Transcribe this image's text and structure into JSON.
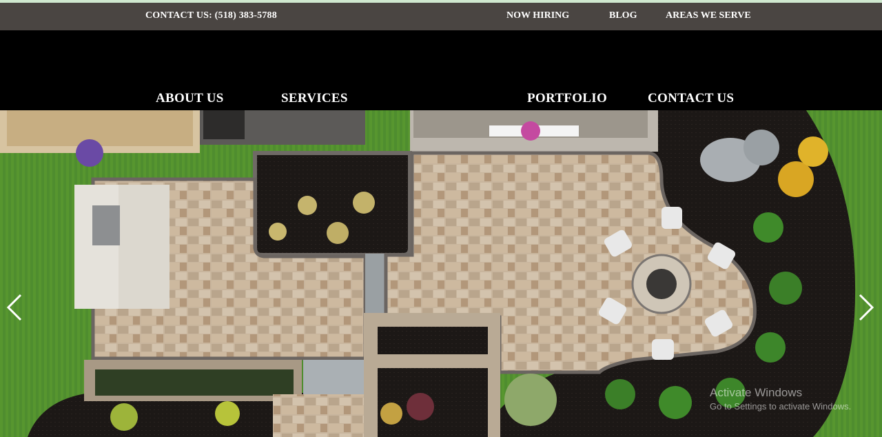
{
  "topbar": {
    "contact": "CONTACT US: (518) 383-5788",
    "links": [
      "NOW HIRING",
      "BLOG",
      "AREAS WE SERVE"
    ]
  },
  "nav": {
    "items": [
      "ABOUT US",
      "SERVICES",
      "PORTFOLIO",
      "CONTACT US"
    ]
  },
  "hero": {
    "prev_icon": "chevron-left-icon",
    "next_icon": "chevron-right-icon"
  },
  "watermark": {
    "title": "Activate Windows",
    "subtitle": "Go to Settings to activate Windows."
  },
  "colors": {
    "accent": "#cfe8cf",
    "topbar": "#4a4542",
    "header": "#000000",
    "lawn": "#4f8d2f",
    "mulch": "#1c1816",
    "paver": "#c9b49a"
  }
}
